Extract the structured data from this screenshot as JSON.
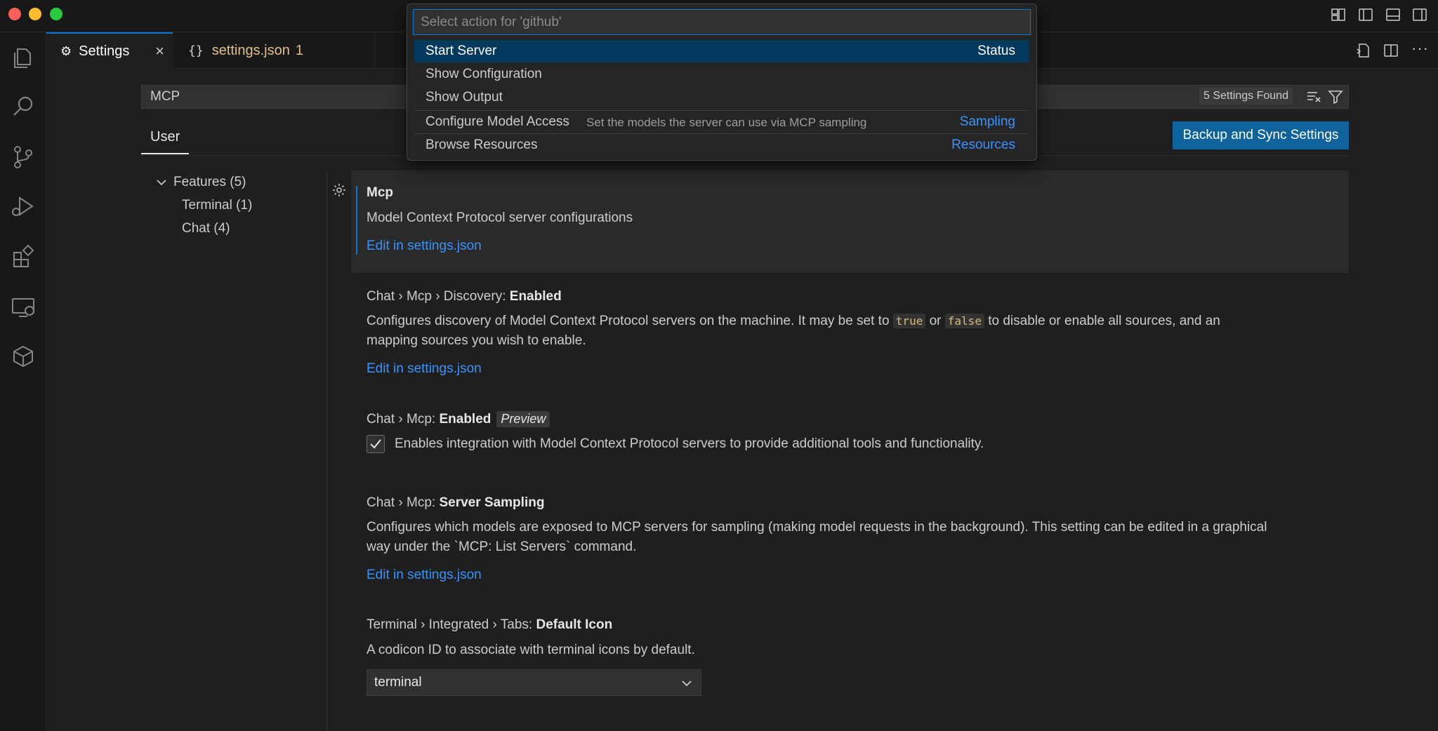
{
  "window": {
    "tabs": [
      {
        "label": "Settings",
        "icon": "settings-icon"
      },
      {
        "label": "settings.json",
        "badge": "1",
        "icon": "braces-icon"
      }
    ]
  },
  "settings": {
    "search": {
      "value": "MCP"
    },
    "found": "5 Settings Found",
    "scope_tab": "User",
    "sync_button": "Backup and Sync Settings",
    "toc": {
      "features": "Features (5)",
      "terminal": "Terminal (1)",
      "chat": "Chat (4)"
    },
    "sections": {
      "mcp": {
        "title": "Mcp",
        "desc": "Model Context Protocol server configurations",
        "link": "Edit in settings.json"
      },
      "discovery": {
        "prefix": "Chat › Mcp › Discovery: ",
        "name": "Enabled",
        "desc_1": "Configures discovery of Model Context Protocol servers on the machine. It may be set to ",
        "code_true": "true",
        "desc_or": " or ",
        "code_false": "false",
        "desc_2": " to disable or enable all sources, and an",
        "desc_line2": "mapping sources you wish to enable.",
        "link": "Edit in settings.json"
      },
      "enabled": {
        "prefix": "Chat › Mcp: ",
        "name": "Enabled",
        "tag": "Preview",
        "checkbox_label": "Enables integration with Model Context Protocol servers to provide additional tools and functionality.",
        "checked": true
      },
      "sampling": {
        "prefix": "Chat › Mcp: ",
        "name": "Server Sampling",
        "desc_line1": "Configures which models are exposed to MCP servers for sampling (making model requests in the background). This setting can be edited in a graphical",
        "desc_line2": "way under the `MCP: List Servers` command.",
        "link": "Edit in settings.json"
      },
      "terminal_icon": {
        "prefix": "Terminal › Integrated › Tabs: ",
        "name": "Default Icon",
        "desc": "A codicon ID to associate with terminal icons by default.",
        "value": "terminal"
      }
    }
  },
  "quickpick": {
    "placeholder": "Select action for 'github'",
    "items": [
      {
        "label": "Start Server",
        "right": "Status"
      },
      {
        "label": "Show Configuration"
      },
      {
        "label": "Show Output"
      },
      {
        "label": "Configure Model Access",
        "description": "Set the models the server can use via MCP sampling",
        "right": "Sampling"
      },
      {
        "label": "Browse Resources",
        "right": "Resources"
      }
    ]
  },
  "colors": {
    "accent": "#0078d4",
    "link": "#3794ff",
    "background": "#1f1f1f",
    "modified_tab": "#e2c08d"
  }
}
